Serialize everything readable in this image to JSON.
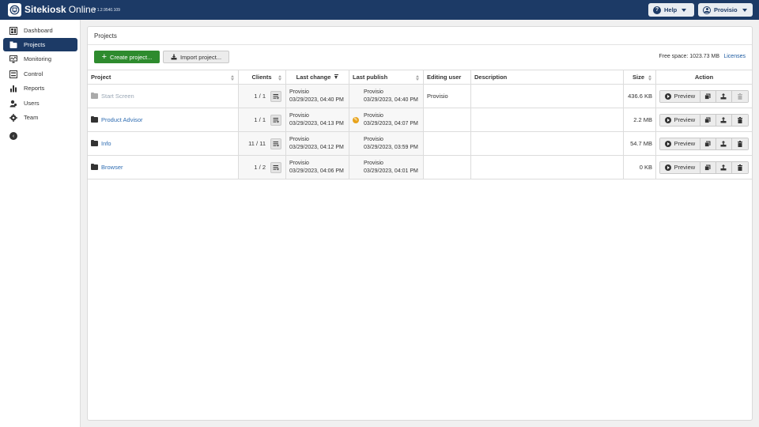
{
  "app": {
    "brand_bold": "Sitekiosk",
    "brand_light": "Online",
    "version": "V 1.2.9540.109"
  },
  "topbar": {
    "help_label": "Help",
    "user_label": "Provisio"
  },
  "sidebar": {
    "items": [
      {
        "label": "Dashboard",
        "icon": "dashboard-icon",
        "active": false
      },
      {
        "label": "Projects",
        "icon": "projects-icon",
        "active": true
      },
      {
        "label": "Monitoring",
        "icon": "monitoring-icon",
        "active": false
      },
      {
        "label": "Control",
        "icon": "control-icon",
        "active": false
      },
      {
        "label": "Reports",
        "icon": "reports-icon",
        "active": false
      },
      {
        "label": "Users",
        "icon": "users-icon",
        "active": false
      },
      {
        "label": "Team",
        "icon": "team-icon",
        "active": false
      }
    ]
  },
  "main": {
    "title": "Projects",
    "create_label": "Create project...",
    "import_label": "Import project...",
    "free_space": "Free space: 1023.73 MB",
    "licenses_label": "Licenses",
    "columns": {
      "project": "Project",
      "clients": "Clients",
      "last_change": "Last change",
      "last_publish": "Last publish",
      "editing_user": "Editing user",
      "description": "Description",
      "size": "Size",
      "action": "Action"
    },
    "preview_label": "Preview",
    "rows": [
      {
        "name": "Start Screen",
        "clients": "1 / 1",
        "change_user": "Provisio",
        "change_date": "03/29/2023, 04:40 PM",
        "publish_user": "Provisio",
        "publish_date": "03/29/2023, 04:40 PM",
        "editing_user": "Provisio",
        "description": "",
        "size": "436.6 KB"
      },
      {
        "name": "Product Advisor",
        "clients": "1 / 1",
        "change_user": "Provisio",
        "change_date": "03/29/2023, 04:13 PM",
        "publish_user": "Provisio",
        "publish_date": "03/29/2023, 04:07 PM",
        "editing_user": "",
        "description": "",
        "size": "2.2 MB"
      },
      {
        "name": "Info",
        "clients": "11 / 11",
        "change_user": "Provisio",
        "change_date": "03/29/2023, 04:12 PM",
        "publish_user": "Provisio",
        "publish_date": "03/29/2023, 03:59 PM",
        "editing_user": "",
        "description": "",
        "size": "54.7 MB"
      },
      {
        "name": "Browser",
        "clients": "1 / 2",
        "change_user": "Provisio",
        "change_date": "03/29/2023, 04:06 PM",
        "publish_user": "Provisio",
        "publish_date": "03/29/2023, 04:01 PM",
        "editing_user": "",
        "description": "",
        "size": "0 KB"
      }
    ]
  },
  "colors": {
    "topbar": "#1c3a66",
    "accent_green": "#2e8b2e",
    "link": "#2f6db2",
    "warning": "#e8a31b"
  }
}
